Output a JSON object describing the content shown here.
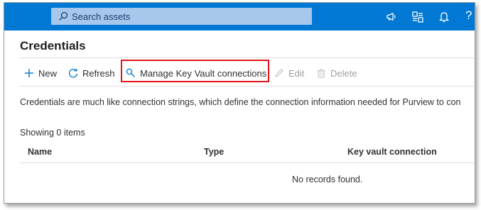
{
  "search": {
    "placeholder": "Search assets"
  },
  "topbar_icons": [
    "megaphone-icon",
    "switch-directory-icon",
    "bell-icon",
    "help-icon"
  ],
  "help_label": "?",
  "page": {
    "title": "Credentials"
  },
  "toolbar": {
    "new_label": "New",
    "refresh_label": "Refresh",
    "manage_kv_label": "Manage Key Vault connections",
    "edit_label": "Edit",
    "delete_label": "Delete"
  },
  "description": "Credentials are much like connection strings, which define the connection information needed for Purview to con",
  "list": {
    "showing": "Showing 0 items",
    "columns": [
      "Name",
      "Type",
      "Key vault connection"
    ],
    "empty": "No records found."
  },
  "colors": {
    "topbar": "#0078d4",
    "highlight": "#e0151b",
    "accent": "#0078d4"
  }
}
